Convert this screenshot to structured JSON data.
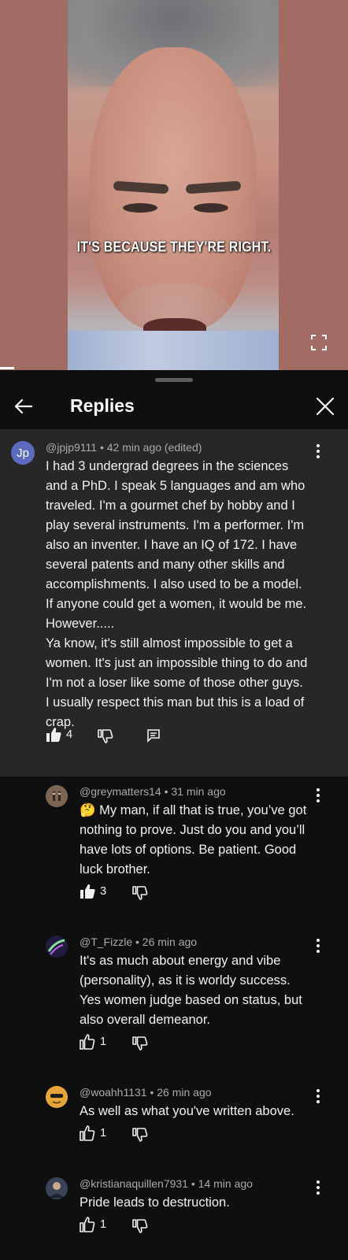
{
  "video": {
    "caption": "IT'S BECAUSE THEY'RE RIGHT."
  },
  "panel": {
    "title": "Replies"
  },
  "main_comment": {
    "avatar_initials": "Jp",
    "author": "@jpjp9111",
    "time": "42 min ago (edited)",
    "body_lines": [
      "I had 3 undergrad degrees in the sciences",
      "and a PhD. I speak 5 languages and am who",
      "traveled. I'm a gourmet chef by hobby and I",
      "play several instruments. I'm a performer. I'm",
      "also an inventer. I have an IQ of 172. I have",
      "several patents and many other skills and",
      "accomplishments. I also used to be a model.",
      "If anyone could get a women, it would be me.",
      "However.....",
      "Ya know, it's still almost impossible to get a",
      "women. It's just an impossible thing to do and",
      "I'm not a loser like some of those other guys.",
      "I usually respect this man but this is a load of",
      "crap."
    ],
    "likes": "4"
  },
  "replies": [
    {
      "author": "@greymatters14",
      "time": "31 min ago",
      "body_lines": [
        "🤔 My man, if all that is true, you’ve got",
        "nothing to prove. Just do you and you’ll",
        "have lots of options. Be patient. Good",
        "luck brother."
      ],
      "likes": "3",
      "liked": true
    },
    {
      "author": "@T_Fizzle",
      "time": "26 min ago",
      "body_lines": [
        "It's as much about energy and vibe",
        "(personality), as it is worldy success.",
        "Yes women judge based on status, but",
        "also overall demeanor."
      ],
      "likes": "1",
      "liked": false
    },
    {
      "author": "@woahh1131",
      "time": "26 min ago",
      "body_lines": [
        "As well as what you've written above."
      ],
      "likes": "1",
      "liked": false
    },
    {
      "author": "@kristianaquillen7931",
      "time": "14 min ago",
      "body_lines": [
        "Pride leads to destruction."
      ],
      "likes": "1",
      "liked": false
    }
  ],
  "meta_separator": " • ",
  "icons": {
    "back": "arrow-left-icon",
    "close": "close-icon",
    "like": "thumbs-up-icon",
    "dislike": "thumbs-down-icon",
    "reply": "reply-icon",
    "more": "more-vertical-icon",
    "fullscreen": "fullscreen-icon"
  },
  "colors": {
    "background": "#0f0f0f",
    "highlight": "#272727",
    "meta_text": "#aaaaaa",
    "text": "#f1f1f1",
    "avatar_main": "#5c6bc0"
  }
}
